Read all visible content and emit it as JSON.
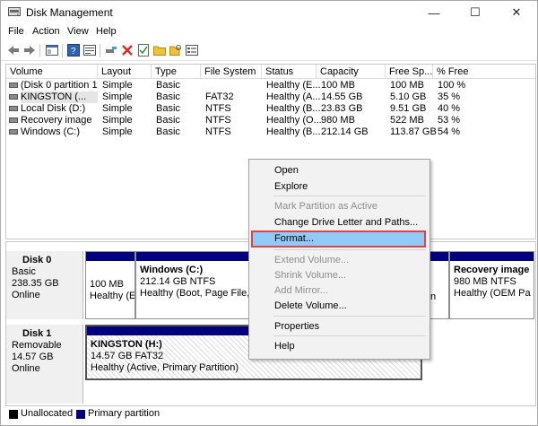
{
  "window": {
    "title": "Disk Management",
    "minimize": "—",
    "maximize": "☐",
    "close": "✕"
  },
  "menu": [
    "File",
    "Action",
    "View",
    "Help"
  ],
  "toolbar": [
    "back-icon",
    "forward-icon",
    "console-icon",
    "help-icon",
    "properties-icon",
    "connect-icon",
    "delete-icon",
    "check-icon",
    "open-folder-icon",
    "find-icon",
    "view-icon"
  ],
  "list": {
    "columns": [
      "Volume",
      "Layout",
      "Type",
      "File System",
      "Status",
      "Capacity",
      "Free Sp...",
      "% Free"
    ],
    "rows": [
      [
        "(Disk 0 partition 1)",
        "Simple",
        "Basic",
        "",
        "Healthy (E...",
        "100 MB",
        "100 MB",
        "100 %"
      ],
      [
        "KINGSTON (...",
        "Simple",
        "Basic",
        "FAT32",
        "Healthy (A...",
        "14.55 GB",
        "5.10 GB",
        "35 %"
      ],
      [
        "Local Disk (D:)",
        "Simple",
        "Basic",
        "NTFS",
        "Healthy (B...",
        "23.83 GB",
        "9.51 GB",
        "40 %"
      ],
      [
        "Recovery image",
        "Simple",
        "Basic",
        "NTFS",
        "Healthy (O...",
        "980 MB",
        "522 MB",
        "53 %"
      ],
      [
        "Windows (C:)",
        "Simple",
        "Basic",
        "NTFS",
        "Healthy (B...",
        "212.14 GB",
        "113.87 GB",
        "54 %"
      ]
    ]
  },
  "disk0": {
    "name": "Disk 0",
    "type": "Basic",
    "size": "238.35 GB",
    "state": "Online",
    "partitions": {
      "p1": {
        "size": "100 MB",
        "status": "Healthy (E"
      },
      "windows": {
        "name": "Windows  (C:)",
        "size": "212.14 GB NTFS",
        "status": "Healthy (Boot, Page File, Cras"
      },
      "mid": {
        "status": "n"
      },
      "recovery": {
        "name": "Recovery image",
        "size": "980 MB NTFS",
        "status": "Healthy (OEM Pa"
      }
    }
  },
  "disk1": {
    "name": "Disk 1",
    "type": "Removable",
    "size": "14.57 GB",
    "state": "Online",
    "partition": {
      "name": "KINGSTON  (H:)",
      "size": "14.57 GB FAT32",
      "status": "Healthy (Active, Primary Partition)"
    }
  },
  "legend": {
    "unallocated": "Unallocated",
    "primary": "Primary partition",
    "unallocated_color": "#000000",
    "primary_color": "#00007f"
  },
  "context_menu": {
    "open": "Open",
    "explore": "Explore",
    "mark_active": "Mark Partition as Active",
    "change_letter": "Change Drive Letter and Paths...",
    "format": "Format...",
    "extend": "Extend Volume...",
    "shrink": "Shrink Volume...",
    "add_mirror": "Add Mirror...",
    "delete": "Delete Volume...",
    "properties": "Properties",
    "help": "Help"
  },
  "colors": {
    "highlight": "#91c9f7",
    "highlight_border": "#e8413b",
    "partition_bar": "#00007f"
  }
}
